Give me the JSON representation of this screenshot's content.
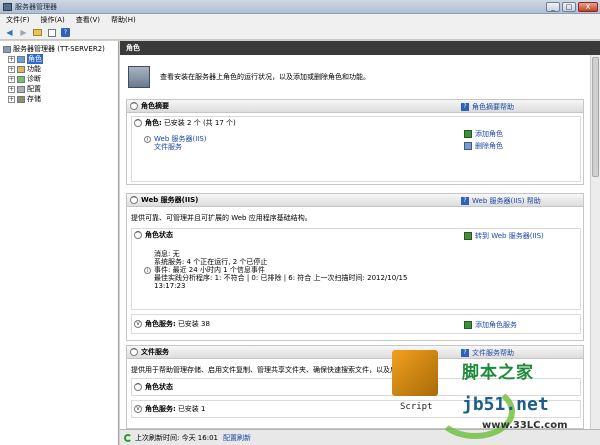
{
  "window": {
    "title": "服务器管理器",
    "minimize": "_",
    "maximize": "□",
    "close": "X"
  },
  "menu": [
    "文件(F)",
    "操作(A)",
    "查看(V)",
    "帮助(H)"
  ],
  "tree": {
    "root": "服务器管理器 (TT-SERVER2)",
    "items": [
      {
        "label": "角色",
        "selected": true
      },
      {
        "label": "功能",
        "selected": false
      },
      {
        "label": "诊断",
        "selected": false
      },
      {
        "label": "配置",
        "selected": false
      },
      {
        "label": "存储",
        "selected": false
      }
    ]
  },
  "main": {
    "header": "角色",
    "intro": "查看安装在服务器上角色的运行状况，以及添加或删除角色和功能。",
    "summary": {
      "title": "角色摘要",
      "help": "角色摘要帮助",
      "roles_label": "角色:",
      "roles_value": "已安装 2 个 (共 17 个)",
      "role_list": [
        "Web 服务器(IIS)",
        "文件服务"
      ],
      "add_role": "添加角色",
      "remove_role": "删除角色"
    },
    "web": {
      "title": "Web 服务器(IIS)",
      "help": "Web 服务器(IIS) 帮助",
      "desc": "提供可靠、可管理并且可扩展的 Web 应用程序基础结构。",
      "status_title": "角色状态",
      "goto": "转到 Web 服务器(IIS)",
      "messages": "消息: 无",
      "system_services": "系统服务: 4 个正在运行, 2 个已停止",
      "events": "事件: 最近 24 小时内 1 个信息事件",
      "bpa_line1": "最佳实践分析程序: 1: 不符合 | 0: 已排除 | 6: 符合    上一次扫描时间: 2012/10/15",
      "bpa_line2": "13:17:23",
      "services_title": "角色服务:",
      "services_value": "已安装 38",
      "add_services": "添加角色服务"
    },
    "file": {
      "title": "文件服务",
      "help": "文件服务帮助",
      "desc": "提供用于帮助管理存储、启用文件复制、管理共享文件夹、确保快速搜索文件，以及启用对 UNIX",
      "status_title": "角色状态",
      "services_title": "角色服务:",
      "services_value": "已安装 1"
    },
    "status": {
      "last_refresh": "上次刷新时间: 今天 16:01",
      "configure_refresh": "配置刷新"
    }
  },
  "watermark": {
    "logo_text": "Script",
    "site_cn": "脚本之家",
    "site_domain": "jb51.net",
    "site_url": "www.33LC.com"
  }
}
